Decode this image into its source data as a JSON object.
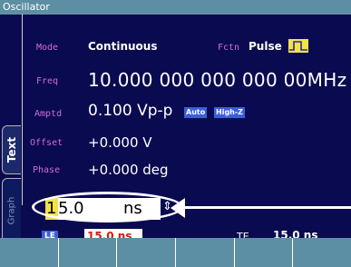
{
  "window": {
    "title": "Oscillator"
  },
  "tabs": {
    "text": "Text",
    "graph": "Graph"
  },
  "params": {
    "mode": {
      "label": "Mode",
      "value": "Continuous"
    },
    "fctn": {
      "label": "Fctn",
      "value": "Pulse"
    },
    "freq": {
      "label": "Freq",
      "value": "10.000 000 000 000 00MHz"
    },
    "amptd": {
      "label": "Amptd",
      "value": "0.100 Vp-p",
      "badges": [
        "Auto",
        "High-Z"
      ]
    },
    "offset": {
      "label": "Offset",
      "value": "+0.000 V"
    },
    "phase": {
      "label": "Phase",
      "value": "+0.000 deg"
    }
  },
  "edit": {
    "cursor_digit": "1",
    "rest": "5.0",
    "unit": "ns"
  },
  "bottom": {
    "le": {
      "label": "LE",
      "value": "15.0  ns"
    },
    "te": {
      "label": "TE",
      "value": "15.0  ns"
    }
  },
  "softkeys": [
    "",
    "",
    "",
    "",
    "",
    ""
  ],
  "colors": {
    "screen_bg": "#0a0a50",
    "title_bg": "#5c8fa3",
    "label": "#d06ad8",
    "accent_yellow": "#f2e24a",
    "badge_blue": "#3b5fd8"
  }
}
